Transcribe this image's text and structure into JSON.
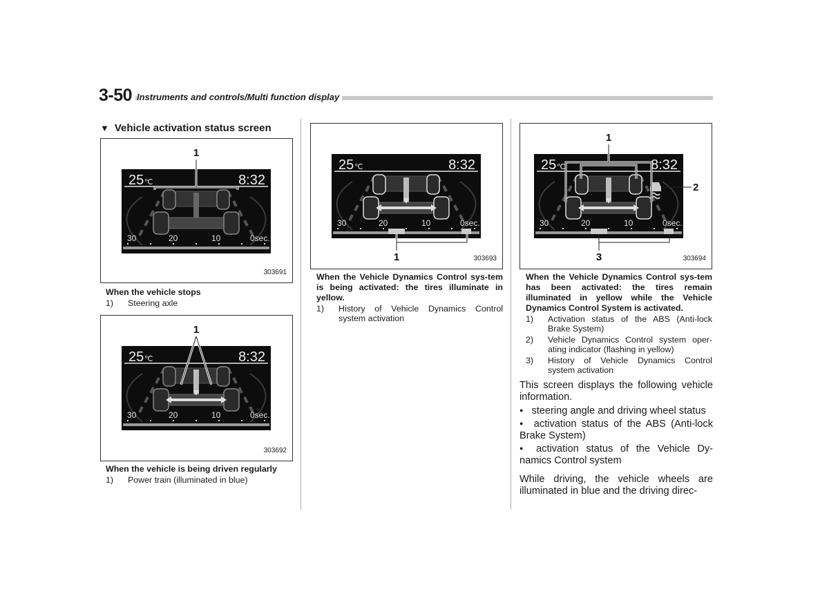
{
  "header": {
    "page_number": "3-50",
    "title": "Instruments and controls/Multi function display"
  },
  "section": {
    "marker": "▼",
    "title": "Vehicle activation status screen"
  },
  "display": {
    "temperature": "25",
    "temp_unit": "℃",
    "clock": "8:32",
    "scale_labels": [
      "30",
      "20",
      "10",
      "0sec."
    ]
  },
  "figures": [
    {
      "id": "303691",
      "callouts": [
        "1"
      ],
      "caption": "When the vehicle stops",
      "items": [
        {
          "num": "1)",
          "text": "Steering axle"
        }
      ]
    },
    {
      "id": "303692",
      "callouts": [
        "1"
      ],
      "caption": "When the vehicle is being driven regularly",
      "items": [
        {
          "num": "1)",
          "text": "Power train (illuminated in blue)"
        }
      ]
    },
    {
      "id": "303693",
      "callouts": [
        "1"
      ],
      "caption": "When the Vehicle Dynamics Control sys-tem is being activated: the tires illuminate in yellow.",
      "items": [
        {
          "num": "1)",
          "text": "History of Vehicle Dynamics Control system activation"
        }
      ]
    },
    {
      "id": "303694",
      "callouts": [
        "1",
        "2",
        "3"
      ],
      "caption": "When the Vehicle Dynamics Control sys-tem has been activated: the tires remain illuminated in yellow while the Vehicle Dynamics Control System is activated.",
      "items": [
        {
          "num": "1)",
          "text": "Activation status of the ABS (Anti-lock Brake System)"
        },
        {
          "num": "2)",
          "text": "Vehicle Dynamics Control system oper-ating indicator (flashing in yellow)"
        },
        {
          "num": "3)",
          "text": "History of Vehicle Dynamics Control system activation"
        }
      ]
    }
  ],
  "body": {
    "intro": "This screen displays the following vehicle information.",
    "bullets": [
      "steering angle and driving wheel status",
      "activation status of the ABS (Anti-lock Brake System)",
      "activation status of the Vehicle Dy-namics Control system"
    ],
    "bullet_marker": "●",
    "closing": "While driving, the vehicle wheels are illuminated in blue and the driving direc-"
  }
}
